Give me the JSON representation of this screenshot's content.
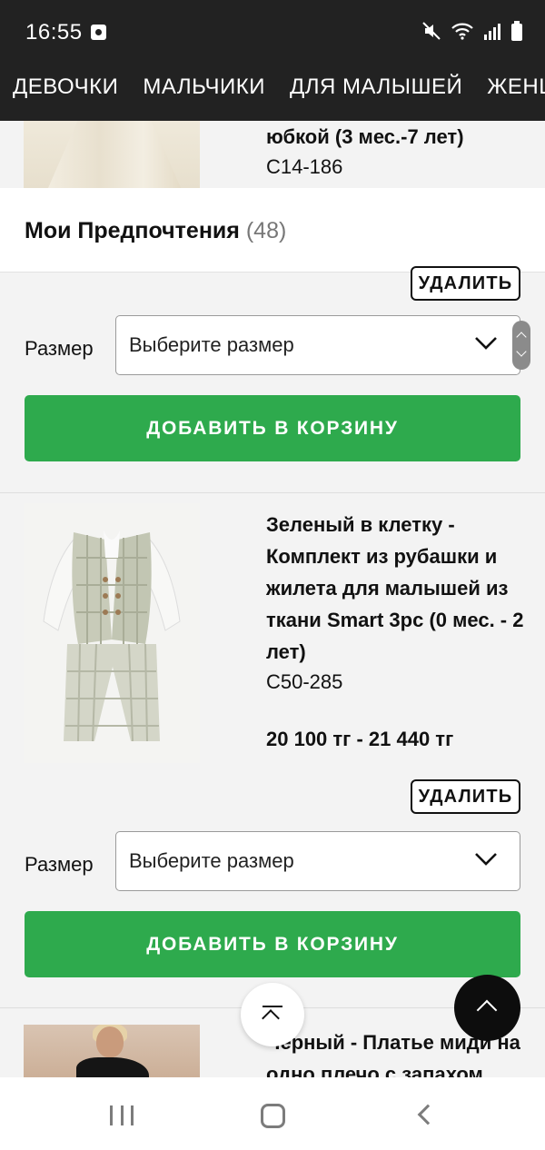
{
  "status_bar": {
    "time": "16:55"
  },
  "categories": [
    "ДЕВОЧКИ",
    "МАЛЬЧИКИ",
    "ДЛЯ МАЛЫШЕЙ",
    "ЖЕНЩИНЫ"
  ],
  "previous_item": {
    "title_fragment": "юбкой (3 мес.-7 лет)",
    "code": "C14-186"
  },
  "preferences": {
    "title": "Мои Предпочтения",
    "count": "(48)"
  },
  "item_1_controls": {
    "remove_label": "УДАЛИТЬ",
    "size_label": "Размер",
    "size_placeholder": "Выберите размер",
    "add_to_cart_label": "ДОБАВИТЬ В КОРЗИНУ"
  },
  "item_2": {
    "title": "Зеленый в клетку - Комплект из рубашки и жилета для малышей из ткани Smart 3pc (0 мес. - 2 лет)",
    "code": "C50-285",
    "price": "20 100 тг - 21 440 тг",
    "remove_label": "УДАЛИТЬ",
    "size_label": "Размер",
    "size_placeholder": "Выберите размер",
    "add_to_cart_label": "ДОБАВИТЬ В КОРЗИНУ"
  },
  "item_3": {
    "title_fragment": "Черный - Платье миди на одно плечо с запахом"
  },
  "colors": {
    "header_bg": "#222222",
    "accent_green": "#2eaa4d",
    "page_bg": "#f3f3f3"
  }
}
